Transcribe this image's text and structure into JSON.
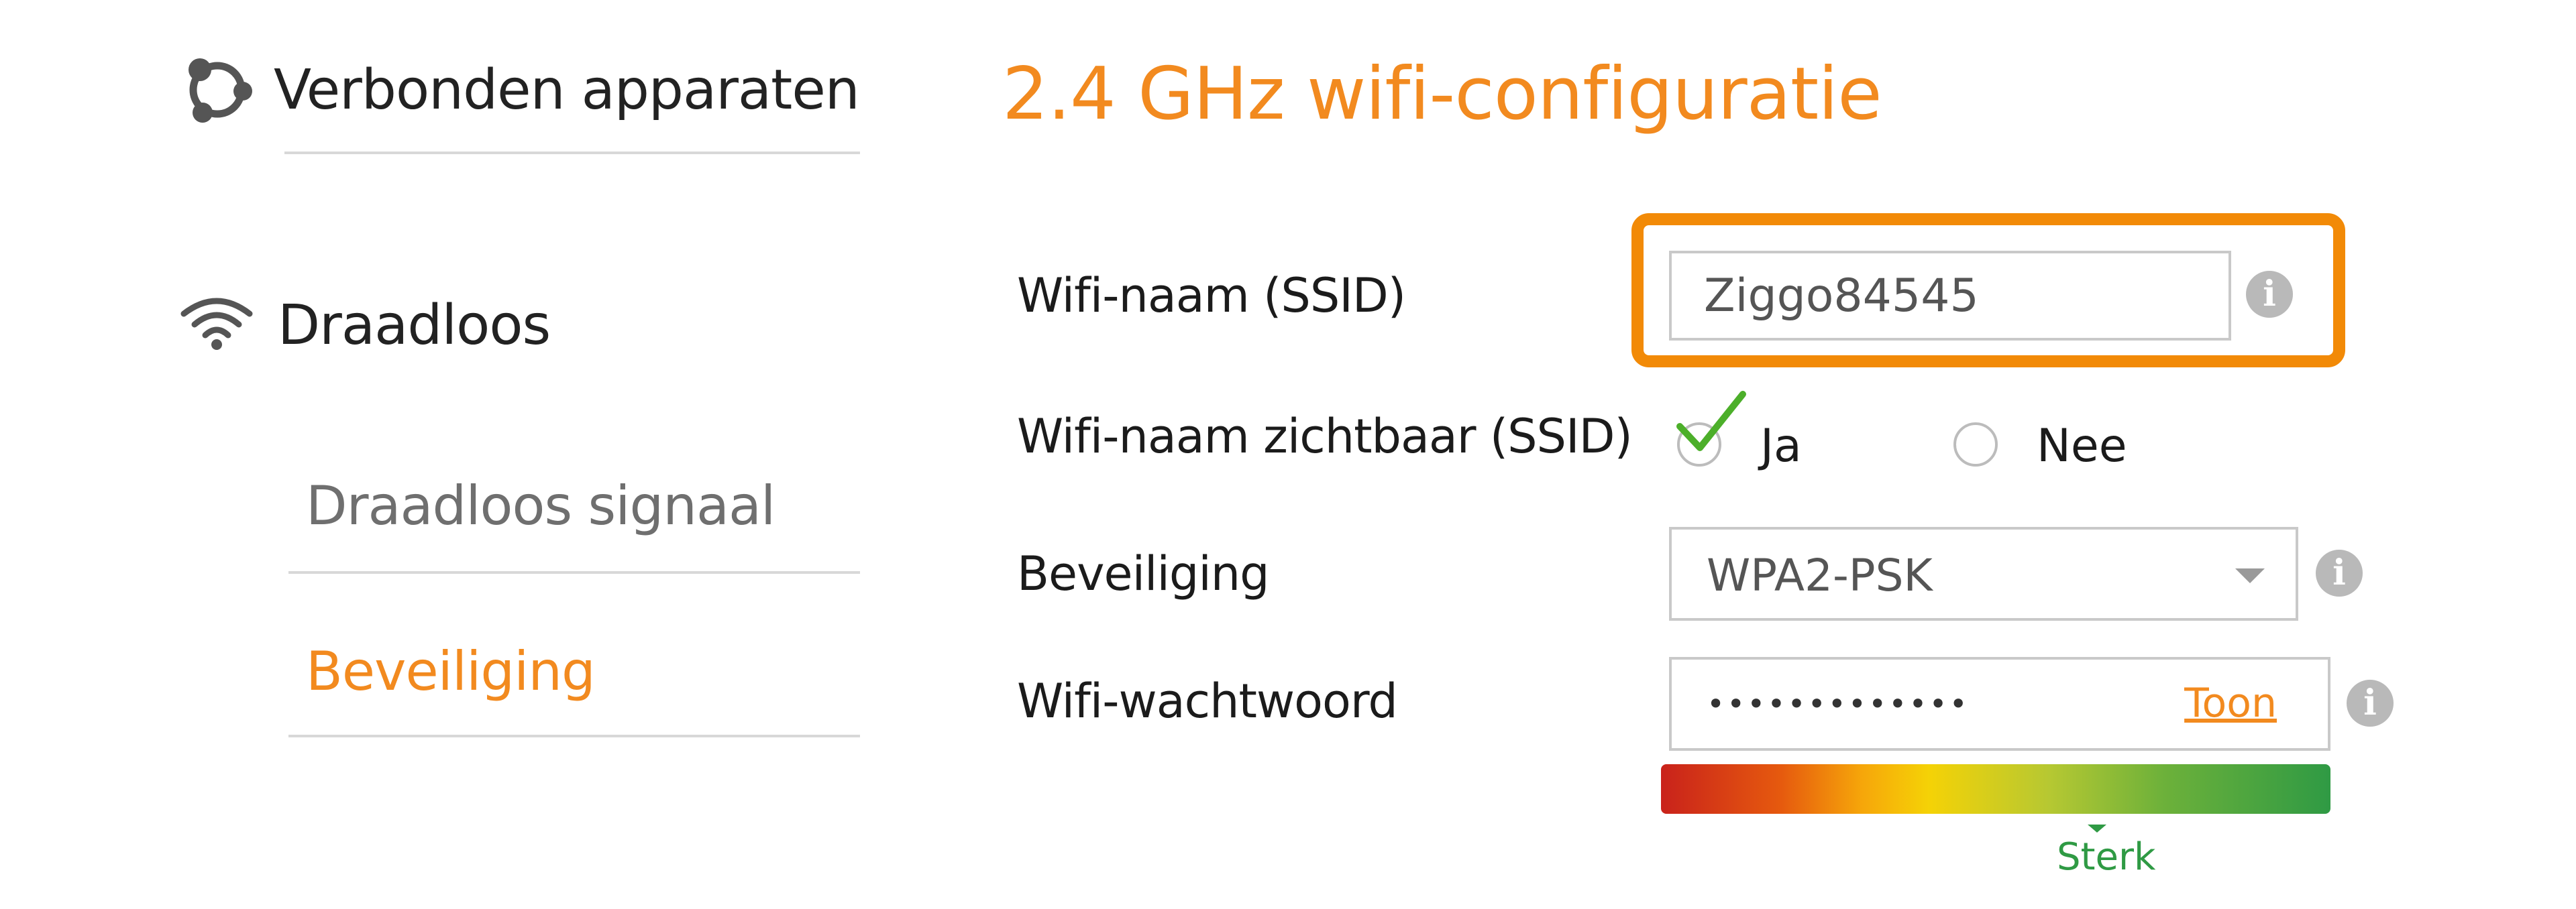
{
  "sidebar": {
    "sections": [
      {
        "label": "Verbonden apparaten",
        "icon": "connected-devices-icon"
      },
      {
        "label": "Draadloos",
        "icon": "wifi-icon",
        "items": [
          {
            "label": "Draadloos signaal",
            "active": false
          },
          {
            "label": "Beveiliging",
            "active": true
          }
        ]
      }
    ]
  },
  "main": {
    "title": "2.4 GHz wifi-configuratie",
    "form": {
      "ssid": {
        "label": "Wifi-naam (SSID)",
        "value": "Ziggo84545",
        "info_icon": "i"
      },
      "visible": {
        "label": "Wifi-naam zichtbaar (SSID)",
        "options": [
          {
            "label": "Ja",
            "selected": true
          },
          {
            "label": "Nee",
            "selected": false
          }
        ]
      },
      "security": {
        "label": "Beveiliging",
        "selected": "WPA2-PSK",
        "info_icon": "i"
      },
      "password": {
        "label": "Wifi-wachtwoord",
        "masked_value": "•••••••••••••",
        "show_label": "Toon",
        "info_icon": "i",
        "strength_label": "Sterk",
        "strength_level": 0.73
      }
    }
  },
  "colors": {
    "accent": "#f28a1f",
    "highlight": "#f28a07",
    "strength_good": "#2f9a44",
    "checkmark": "#4caf2a"
  }
}
